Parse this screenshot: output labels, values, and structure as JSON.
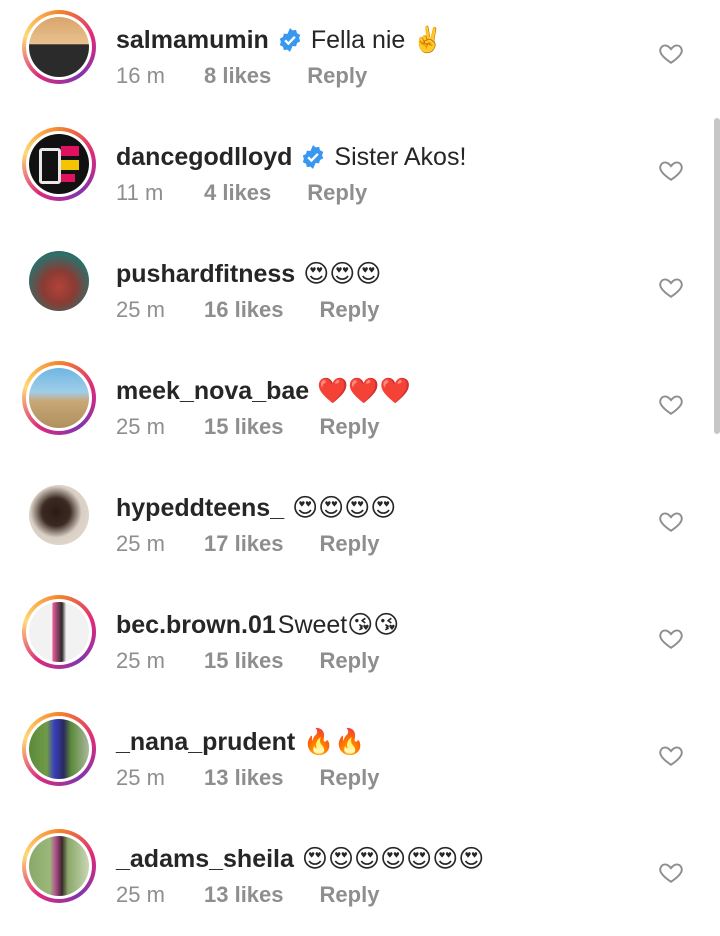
{
  "comments": [
    {
      "username": "salmamumin",
      "verified": true,
      "text": "Fella nie ✌️",
      "time": "16 m",
      "likes": "8 likes",
      "reply": "Reply",
      "avatar_ring": "gradient",
      "avatar_colors": [
        "#d9a46a",
        "#2b2b2b"
      ]
    },
    {
      "username": "dancegodlloyd",
      "verified": true,
      "text": "Sister Akos!",
      "time": "11 m",
      "likes": "4 likes",
      "reply": "Reply",
      "avatar_ring": "gradient",
      "avatar_colors": [
        "#111111",
        "#e0115f"
      ]
    },
    {
      "username": "pushardfitness",
      "verified": false,
      "text": "😍😍😍",
      "time": "25 m",
      "likes": "16 likes",
      "reply": "Reply",
      "avatar_ring": "none",
      "avatar_colors": [
        "#2f6f6a",
        "#b2433a"
      ]
    },
    {
      "username": "meek_nova_bae",
      "verified": false,
      "text": "❤️❤️❤️",
      "time": "25 m",
      "likes": "15 likes",
      "reply": "Reply",
      "avatar_ring": "gradient",
      "avatar_colors": [
        "#6fb6e3",
        "#c9a877"
      ]
    },
    {
      "username": "hypeddteens_",
      "verified": false,
      "text": "😍😍😍😍",
      "time": "25 m",
      "likes": "17 likes",
      "reply": "Reply",
      "avatar_ring": "none",
      "avatar_colors": [
        "#e8e0d6",
        "#2a1b16"
      ]
    },
    {
      "username": "bec.brown.01",
      "verified": false,
      "text": "Sweet😘😘",
      "time": "25 m",
      "likes": "15 likes",
      "reply": "Reply",
      "avatar_ring": "gradient",
      "avatar_colors": [
        "#f2f2f2",
        "#e75b9a"
      ]
    },
    {
      "username": "_nana_prudent",
      "verified": false,
      "text": "🔥🔥",
      "time": "25 m",
      "likes": "13 likes",
      "reply": "Reply",
      "avatar_ring": "gradient",
      "avatar_colors": [
        "#5c8a3a",
        "#3a3fbf"
      ]
    },
    {
      "username": "_adams_sheila",
      "verified": false,
      "text": "😍😍😍😍😍😍😍",
      "time": "25 m",
      "likes": "13 likes",
      "reply": "Reply",
      "avatar_ring": "gradient",
      "avatar_colors": [
        "#8aa86a",
        "#b04a8d"
      ]
    }
  ],
  "icons": {
    "verified": "verified-badge-icon",
    "like": "heart-outline-icon"
  },
  "colors": {
    "verified": "#3897f0",
    "muted": "#8e8e8e",
    "text": "#262626"
  }
}
